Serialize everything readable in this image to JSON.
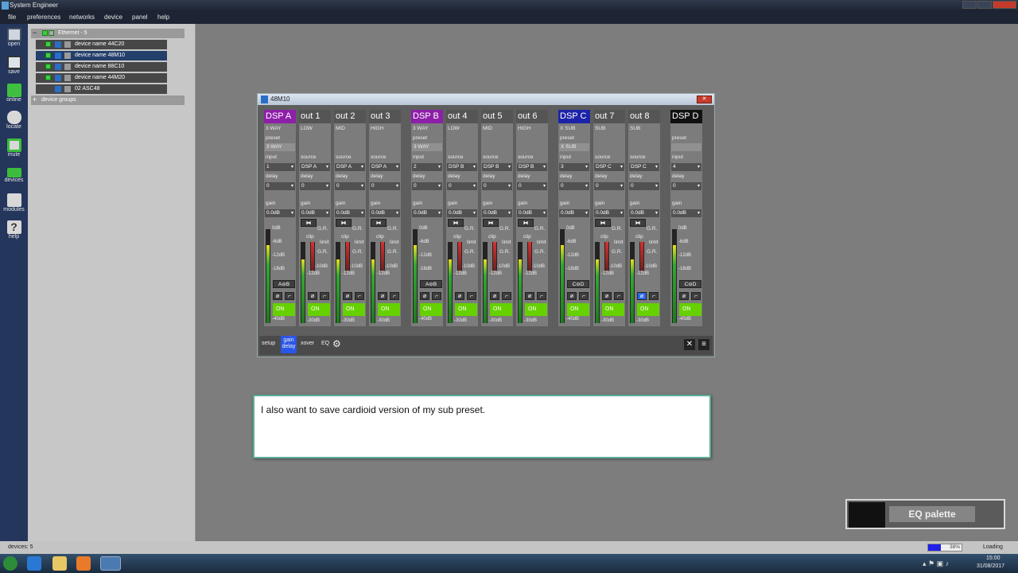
{
  "app": {
    "title": "System Engineer"
  },
  "menu": [
    "file",
    "preferences",
    "networks",
    "device",
    "panel",
    "help"
  ],
  "sidebar": {
    "items": [
      "open",
      "save",
      "online",
      "locate",
      "mute",
      "devices",
      "modules",
      "help"
    ]
  },
  "tree": {
    "network": "Ethernet - 5",
    "devices": [
      "device name 44C20",
      "device name 48M10",
      "device name 88C10",
      "device name 44M20",
      "02 ASC48"
    ],
    "groups": "device groups"
  },
  "mixer": {
    "title": "48M10",
    "labels": {
      "preset": "preset",
      "input": "input",
      "source": "source",
      "delay": "delay",
      "gain": "gain",
      "clip": "clip",
      "limit": "limit",
      "gr": "G.R.",
      "on": "ON",
      "phase": "ø"
    },
    "strips": [
      {
        "name": "DSP A",
        "type": "dsp",
        "color": "#8e1fa8",
        "sub": "3 WAY",
        "preset": "3 WAY",
        "sel": "1",
        "delay": "0",
        "gain": "0.0dB",
        "mode": "A⊖B",
        "level": 0.83
      },
      {
        "name": "out 1",
        "type": "out",
        "sub": "LOW",
        "sel": "DSP A",
        "delay": "0",
        "gain": "0.0dB",
        "level": 0.78
      },
      {
        "name": "out 2",
        "type": "out",
        "sub": "MID",
        "sel": "DSP A",
        "delay": "0",
        "gain": "0.0dB",
        "level": 0.78
      },
      {
        "name": "out 3",
        "type": "out",
        "sub": "HIGH",
        "sel": "DSP A",
        "delay": "0",
        "gain": "0.0dB",
        "level": 0.78
      },
      {
        "name": "DSP B",
        "type": "dsp",
        "color": "#8e1fa8",
        "sub": "3 WAY",
        "preset": "3 WAY",
        "sel": "2",
        "delay": "0",
        "gain": "0.0dB",
        "mode": "A⊖B",
        "level": 0.83
      },
      {
        "name": "out 4",
        "type": "out",
        "sub": "LOW",
        "sel": "DSP B",
        "delay": "0",
        "gain": "0.0dB",
        "level": 0.78
      },
      {
        "name": "out 5",
        "type": "out",
        "sub": "MID",
        "sel": "DSP B",
        "delay": "0",
        "gain": "0.0dB",
        "level": 0.78
      },
      {
        "name": "out 6",
        "type": "out",
        "sub": "HIGH",
        "sel": "DSP B",
        "delay": "0",
        "gain": "0.0dB",
        "level": 0.78
      },
      {
        "name": "DSP C",
        "type": "dsp",
        "color": "#1c23a8",
        "sub": "X SUB",
        "preset": "X SUB",
        "sel": "3",
        "delay": "0",
        "gain": "0.0dB",
        "mode": "C⊖D",
        "level": 0.83
      },
      {
        "name": "out 7",
        "type": "out",
        "sub": "SUB",
        "sel": "DSP C",
        "delay": "0",
        "gain": "0.0dB",
        "level": 0.78
      },
      {
        "name": "out 8",
        "type": "out",
        "sub": "SUB",
        "sel": "DSP C",
        "delay": "0",
        "gain": "0.0dB",
        "level": 0.78,
        "phaseActive": true
      },
      {
        "name": "DSP D",
        "type": "dsp",
        "color": "#111111",
        "sub": "",
        "preset": "",
        "sel": "4",
        "delay": "0",
        "gain": "0.0dB",
        "mode": "C⊖D",
        "level": 0.83
      }
    ],
    "dspTicks": [
      "0dB",
      "-6dB",
      "-12dB",
      "-18dB",
      "-40dB"
    ],
    "outTicks": [
      "-10dB",
      "-12dB",
      "-30dB"
    ],
    "tabs": [
      "setup",
      "gain delay",
      "xover",
      "EQ"
    ]
  },
  "subtitle": "I also want to save cardioid version of my sub preset.",
  "eq_palette": "EQ palette",
  "status": {
    "devices": "devices: 5",
    "progress": "38%",
    "progress_value": 0.38,
    "loading": "Loading"
  },
  "taskbar": {
    "time": "15:00",
    "date": "31/08/2017"
  },
  "colors": {
    "on": "#66d100",
    "accent": "#2a56e8"
  }
}
